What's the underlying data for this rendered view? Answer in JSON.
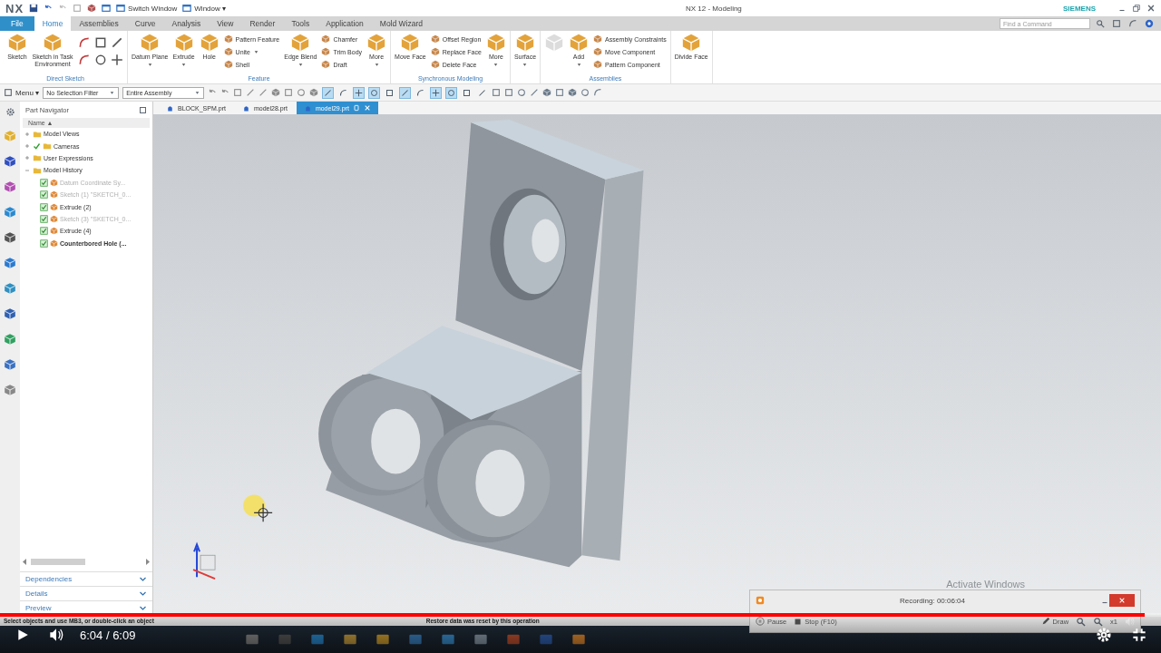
{
  "title_bar": {
    "logo": "NX",
    "switch_window": "Switch Window",
    "window_menu": "Window ▾",
    "title": "NX 12 - Modeling",
    "brand": "SIEMENS"
  },
  "ribbon_tabs": [
    {
      "label": "File",
      "selected": false,
      "kind": "file"
    },
    {
      "label": "Home",
      "selected": true,
      "kind": "tab"
    },
    {
      "label": "Assemblies",
      "selected": false,
      "kind": "tab"
    },
    {
      "label": "Curve",
      "selected": false,
      "kind": "tab"
    },
    {
      "label": "Analysis",
      "selected": false,
      "kind": "tab"
    },
    {
      "label": "View",
      "selected": false,
      "kind": "tab"
    },
    {
      "label": "Render",
      "selected": false,
      "kind": "tab"
    },
    {
      "label": "Tools",
      "selected": false,
      "kind": "tab"
    },
    {
      "label": "Application",
      "selected": false,
      "kind": "tab"
    },
    {
      "label": "Mold Wizard",
      "selected": false,
      "kind": "tab"
    }
  ],
  "search": {
    "placeholder": "Find a Command"
  },
  "ribbon_groups": [
    {
      "label": "Direct Sketch",
      "items": [
        {
          "kind": "large",
          "label": "Sketch",
          "dropdown": false
        },
        {
          "kind": "large",
          "label": "Sketch in Task Environment",
          "dropdown": false
        },
        {
          "kind": "sketch_tools"
        }
      ]
    },
    {
      "label": "Feature",
      "items": [
        {
          "kind": "large",
          "label": "Datum Plane",
          "dropdown": true
        },
        {
          "kind": "large",
          "label": "Extrude",
          "dropdown": true
        },
        {
          "kind": "large",
          "label": "Hole",
          "dropdown": false
        },
        {
          "kind": "stack",
          "entries": [
            {
              "label": "Pattern Feature",
              "dropdown": false
            },
            {
              "label": "Unite",
              "dropdown": true
            },
            {
              "label": "Shell",
              "dropdown": false
            }
          ]
        },
        {
          "kind": "large",
          "label": "Edge Blend",
          "dropdown": true
        },
        {
          "kind": "stack",
          "entries": [
            {
              "label": "Chamfer",
              "dropdown": false
            },
            {
              "label": "Trim Body",
              "dropdown": false
            },
            {
              "label": "Draft",
              "dropdown": false
            }
          ]
        },
        {
          "kind": "large",
          "label": "More",
          "dropdown": true
        }
      ]
    },
    {
      "label": "Synchronous Modeling",
      "items": [
        {
          "kind": "large",
          "label": "Move Face",
          "dropdown": false
        },
        {
          "kind": "stack",
          "entries": [
            {
              "label": "Offset Region",
              "dropdown": false
            },
            {
              "label": "Replace Face",
              "dropdown": false
            },
            {
              "label": "Delete Face",
              "dropdown": false
            }
          ]
        },
        {
          "kind": "large",
          "label": "More",
          "dropdown": true
        }
      ]
    },
    {
      "items": [
        {
          "kind": "large",
          "label": "Surface",
          "dropdown": true
        }
      ]
    },
    {
      "label": "Assemblies",
      "items": [
        {
          "kind": "large",
          "disabled": true
        },
        {
          "kind": "large",
          "label": "Add",
          "dropdown": true
        },
        {
          "kind": "stack",
          "entries": [
            {
              "label": "Assembly Constraints",
              "dropdown": false
            },
            {
              "label": "Move Component",
              "dropdown": false
            },
            {
              "label": "Pattern Component",
              "dropdown": false
            }
          ]
        }
      ]
    },
    {
      "items": [
        {
          "kind": "large",
          "label": "Divide Face",
          "dropdown": false
        }
      ]
    }
  ],
  "toolbar": {
    "menu": "Menu ▾",
    "filters": [
      "No Selection Filter",
      "Entire Assembly"
    ],
    "snap_tools": [
      {
        "on": true
      },
      {
        "on": false
      },
      {
        "on": true
      },
      {
        "on": true
      },
      {
        "on": false
      },
      {
        "on": true
      },
      {
        "on": false
      },
      {
        "on": true
      },
      {
        "on": true
      },
      {
        "on": false
      },
      {
        "on": false
      }
    ]
  },
  "part_navigator": {
    "title": "Part Navigator",
    "column": "Name ▲",
    "tree": [
      {
        "label": "Model Views",
        "expanded": false
      },
      {
        "label": "Cameras",
        "expanded": false,
        "checked": true
      },
      {
        "label": "User Expressions",
        "expanded": false
      },
      {
        "label": "Model History",
        "expanded": true,
        "children": [
          {
            "label": "Datum Coordinate Sy...",
            "checked": true,
            "dimmed": true,
            "current": false
          },
          {
            "label": "Sketch (1) \"SKETCH_0...",
            "checked": true,
            "dimmed": true,
            "current": false
          },
          {
            "label": "Extrude (2)",
            "checked": true,
            "dimmed": false,
            "current": false
          },
          {
            "label": "Sketch (3) \"SKETCH_0...",
            "checked": true,
            "dimmed": true,
            "current": false
          },
          {
            "label": "Extrude (4)",
            "checked": true,
            "dimmed": false,
            "current": false
          },
          {
            "label": "Counterbored Hole (...",
            "checked": true,
            "dimmed": false,
            "current": true
          }
        ]
      }
    ],
    "panels": [
      {
        "label": "Dependencies",
        "expanded": false
      },
      {
        "label": "Details",
        "expanded": false
      },
      {
        "label": "Preview",
        "expanded": false
      }
    ]
  },
  "file_tabs": [
    {
      "label": "BLOCK_SPM.prt",
      "selected": false
    },
    {
      "label": "model28.prt",
      "selected": false
    },
    {
      "label": "model29.prt",
      "selected": true
    }
  ],
  "activation_notice": "Activate Windows",
  "status_bar": {
    "prompt": "Select objects and use MB3, or double-click an object",
    "message": "Restore data was reset by this operation"
  },
  "recorder": {
    "title": "Recording: 00:06:04",
    "pause": "Pause",
    "stop": "Stop (F10)",
    "draw": "Draw",
    "zoom": "x1"
  },
  "player": {
    "progress": {
      "level": 0.986
    },
    "time": "6:04 / 6:09"
  }
}
